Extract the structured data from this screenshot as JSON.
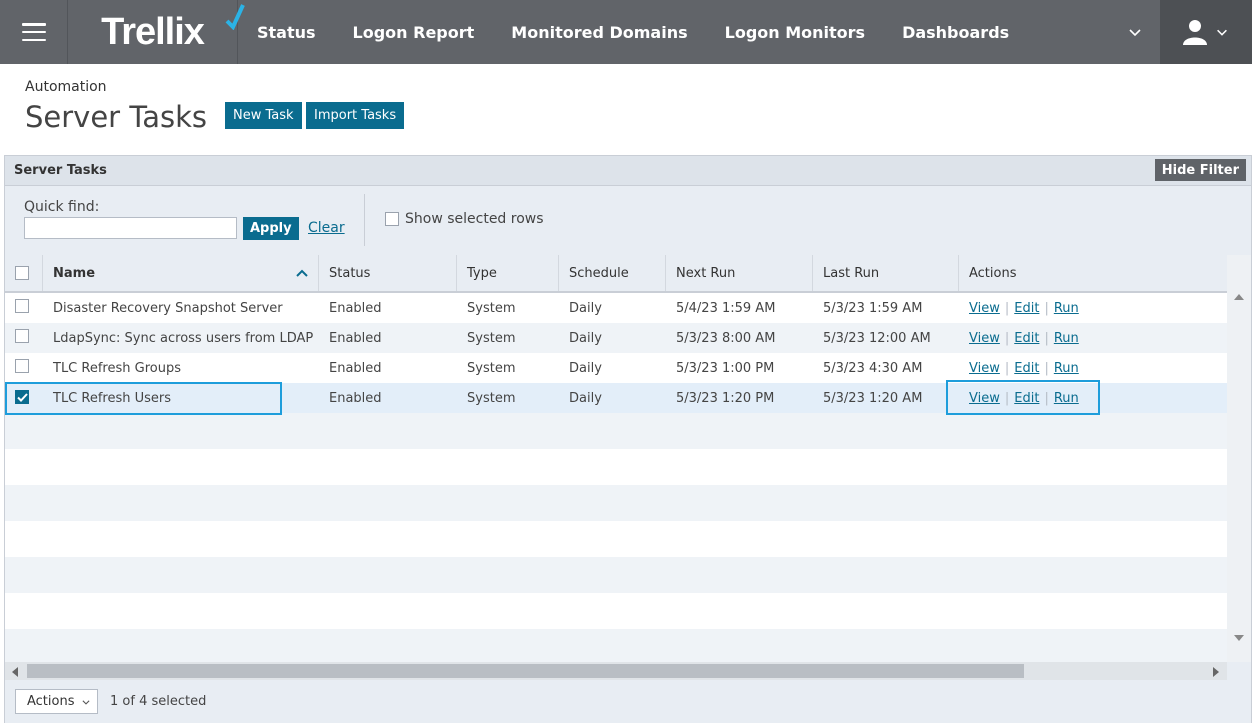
{
  "nav": {
    "logo": "Trellix",
    "items": [
      "Status",
      "Logon Report",
      "Monitored Domains",
      "Logon Monitors",
      "Dashboards"
    ]
  },
  "header": {
    "breadcrumb": "Automation",
    "title": "Server Tasks",
    "new_task": "New Task",
    "import_tasks": "Import Tasks"
  },
  "panel": {
    "title": "Server Tasks",
    "hide_filter": "Hide Filter",
    "quick_find_label": "Quick find:",
    "quick_find_value": "",
    "apply": "Apply",
    "clear": "Clear",
    "show_selected": "Show selected rows"
  },
  "table": {
    "columns": [
      "Name",
      "Status",
      "Type",
      "Schedule",
      "Next Run",
      "Last Run",
      "Actions"
    ],
    "rows": [
      {
        "name": "Disaster Recovery Snapshot Server",
        "status": "Enabled",
        "type": "System",
        "schedule": "Daily",
        "next_run": "5/4/23 1:59 AM",
        "last_run": "5/3/23 1:59 AM",
        "checked": false
      },
      {
        "name": "LdapSync: Sync across users from LDAP",
        "status": "Enabled",
        "type": "System",
        "schedule": "Daily",
        "next_run": "5/3/23 8:00 AM",
        "last_run": "5/3/23 12:00 AM",
        "checked": false
      },
      {
        "name": "TLC Refresh Groups",
        "status": "Enabled",
        "type": "System",
        "schedule": "Daily",
        "next_run": "5/3/23 1:00 PM",
        "last_run": "5/3/23 4:30 AM",
        "checked": false
      },
      {
        "name": "TLC Refresh Users",
        "status": "Enabled",
        "type": "System",
        "schedule": "Daily",
        "next_run": "5/3/23 1:20 PM",
        "last_run": "5/3/23 1:20 AM",
        "checked": true
      }
    ],
    "action_links": [
      "View",
      "Edit",
      "Run"
    ]
  },
  "footer": {
    "actions_label": "Actions",
    "selected_text": "1 of 4 selected"
  },
  "colors": {
    "nav_bg": "#616469",
    "primary": "#0a6c8f",
    "highlight": "#1e9ddb",
    "logo_check": "#2bb3e6"
  }
}
